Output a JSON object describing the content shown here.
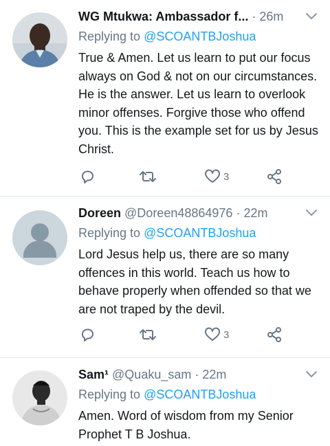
{
  "colors": {
    "link": "#1da1f2",
    "muted": "#657786",
    "text": "#14171a",
    "divider": "#e1e8ed"
  },
  "tweets": [
    {
      "name": "WG Mtukwa: Ambassador f...",
      "handle": "",
      "dot": "·",
      "time": "26m",
      "replying_label": "Replying to",
      "replying_to": "@SCOANTBJoshua",
      "text": "True & Amen. Let us learn to put our focus always on God & not on our circumstances. He is the answer. Let us learn to overlook minor offenses. Forgive those who offend you. This is the example set for us by Jesus Christ.",
      "like_count": "3"
    },
    {
      "name": "Doreen",
      "handle": "@Doreen48864976",
      "dot": "·",
      "time": "22m",
      "replying_label": "Replying to",
      "replying_to": "@SCOANTBJoshua",
      "text": "Lord Jesus help us, there are so many offences in this world. Teach us how to behave properly when offended so that we are not traped by the devil.",
      "like_count": "3"
    },
    {
      "name": "Sam¹",
      "handle": "@Quaku_sam",
      "dot": "·",
      "time": "22m",
      "replying_label": "Replying to",
      "replying_to": "@SCOANTBJoshua",
      "text": "Amen. Word of wisdom from my Senior Prophet T B Joshua."
    }
  ],
  "icons": {
    "reply": "reply-icon",
    "retweet": "retweet-icon",
    "like": "heart-icon",
    "share": "share-icon",
    "more": "chevron-down-icon"
  }
}
